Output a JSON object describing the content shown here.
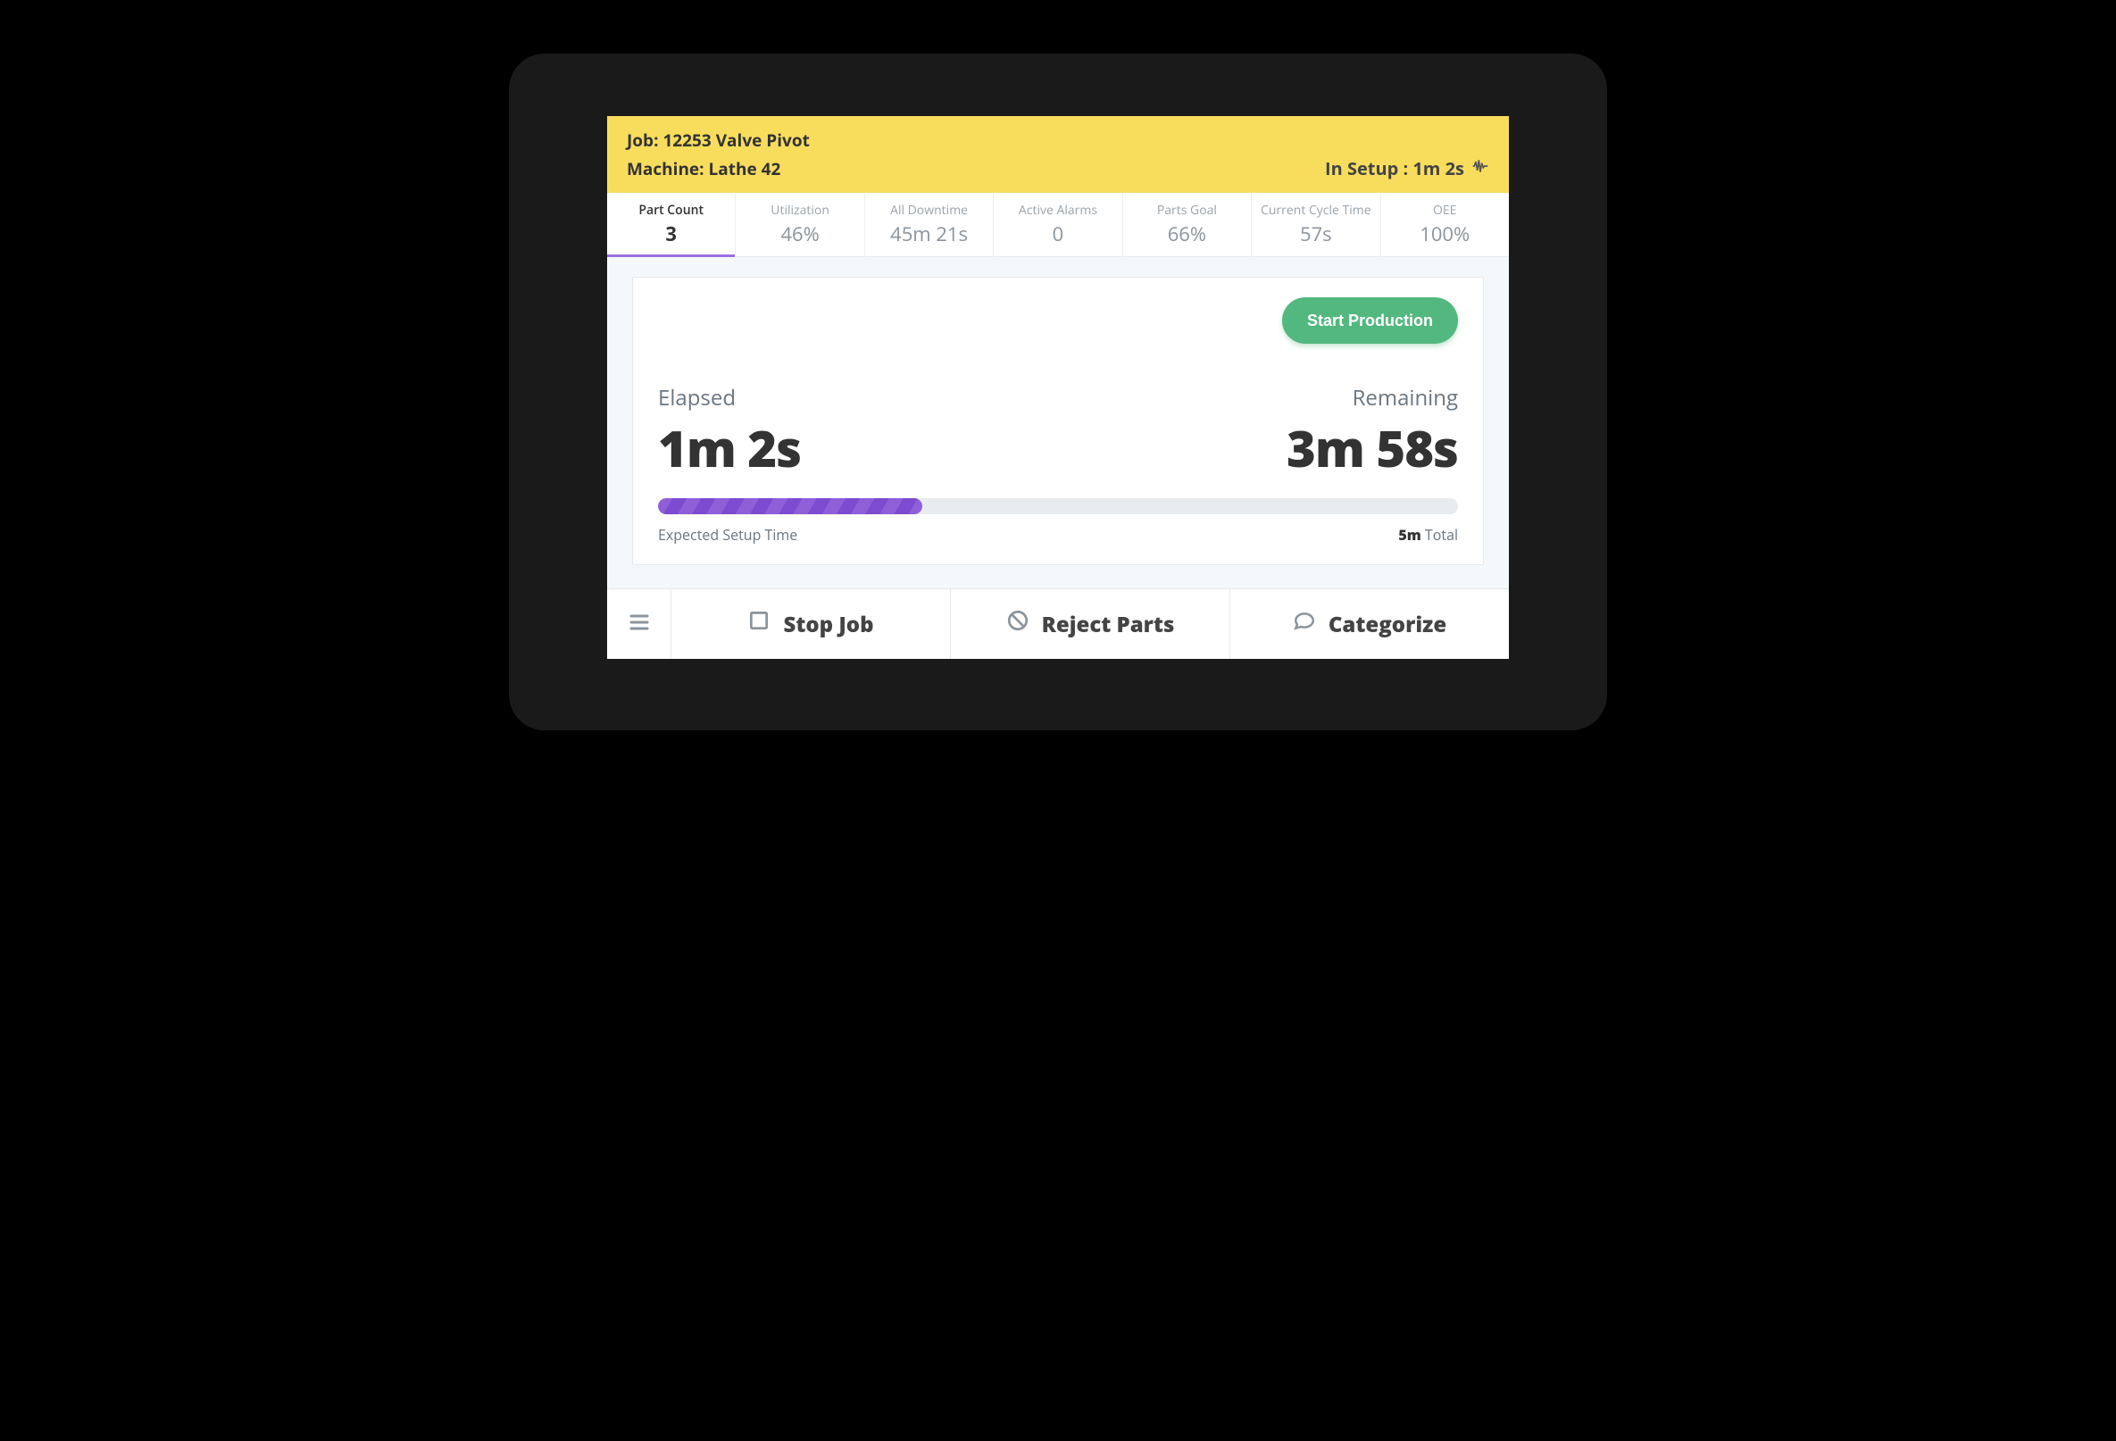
{
  "header": {
    "job_label": "Job:",
    "job_value": "12253 Valve Pivot",
    "machine_label": "Machine:",
    "machine_value": "Lathe 42",
    "status_text": "In Setup : 1m 2s"
  },
  "metrics": [
    {
      "label": "Part Count",
      "value": "3",
      "active": true
    },
    {
      "label": "Utilization",
      "value": "46%",
      "active": false
    },
    {
      "label": "All Downtime",
      "value": "45m 21s",
      "active": false
    },
    {
      "label": "Active Alarms",
      "value": "0",
      "active": false
    },
    {
      "label": "Parts Goal",
      "value": "66%",
      "active": false
    },
    {
      "label": "Current Cycle Time",
      "value": "57s",
      "active": false
    },
    {
      "label": "OEE",
      "value": "100%",
      "active": false
    }
  ],
  "card": {
    "start_button": "Start Production",
    "elapsed_label": "Elapsed",
    "elapsed_value": "1m 2s",
    "remaining_label": "Remaining",
    "remaining_value": "3m 58s",
    "progress_percent": 33,
    "expected_label": "Expected Setup Time",
    "total_value": "5m",
    "total_label": "Total"
  },
  "actions": {
    "stop_job": "Stop Job",
    "reject_parts": "Reject Parts",
    "categorize": "Categorize"
  }
}
